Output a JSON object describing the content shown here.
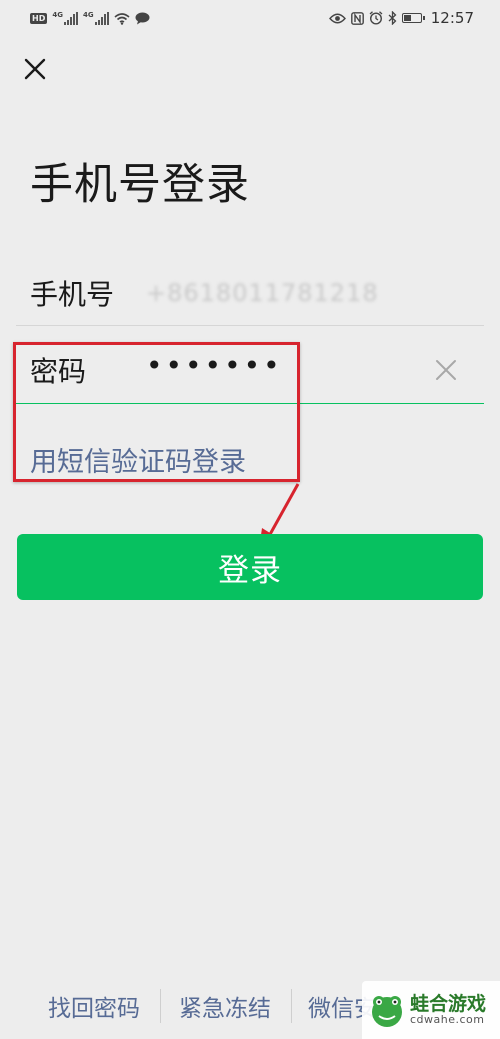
{
  "status_bar": {
    "hd_label": "HD",
    "net1_label": "4G",
    "net2_label": "4G",
    "battery_level": 0.4,
    "time": "12:57"
  },
  "header": {
    "close_icon": "close-icon",
    "title": "手机号登录"
  },
  "form": {
    "phone": {
      "label": "手机号",
      "value": "+8618011781218"
    },
    "password": {
      "label": "密码",
      "masked_value": "•••••••",
      "clear_icon": "clear-x-icon"
    },
    "sms_login_link": "用短信验证码登录"
  },
  "login_button": {
    "label": "登录"
  },
  "footer": {
    "links": [
      "找回密码",
      "紧急冻结",
      "微信安"
    ]
  },
  "watermark": {
    "main": "蛙合游戏",
    "sub": "cdwahe.com"
  },
  "colors": {
    "accent_green": "#07c160",
    "link_blue": "#576b95",
    "annotation_red": "#d7242e",
    "background": "#ededed"
  }
}
